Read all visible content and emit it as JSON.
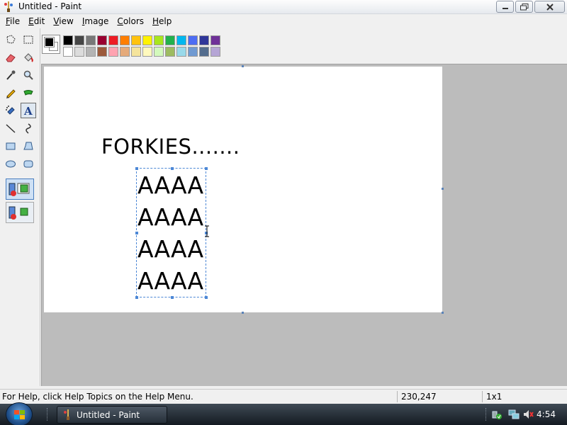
{
  "window": {
    "title": "Untitled - Paint"
  },
  "menu": [
    {
      "underline": "F",
      "rest": "ile"
    },
    {
      "underline": "E",
      "rest": "dit"
    },
    {
      "underline": "V",
      "rest": "iew"
    },
    {
      "underline": "I",
      "rest": "mage"
    },
    {
      "underline": "C",
      "rest": "olors"
    },
    {
      "underline": "H",
      "rest": "elp"
    }
  ],
  "tools": [
    "free-form-select",
    "select",
    "eraser",
    "fill-with-color",
    "pick-color",
    "magnifier",
    "pencil",
    "brush",
    "airbrush",
    "text",
    "line",
    "curve",
    "rectangle",
    "polygon",
    "ellipse",
    "rounded-rectangle"
  ],
  "selected_tool": "text",
  "colors": {
    "foreground": "#000000",
    "background": "#ffffff",
    "palette": [
      "#000000",
      "#464646",
      "#787878",
      "#990030",
      "#ed1c24",
      "#ff7e00",
      "#ffc20e",
      "#fff200",
      "#a8e61d",
      "#22b14c",
      "#00b7ef",
      "#4d6df3",
      "#2f3699",
      "#6f3198",
      "#ffffff",
      "#dcdcdc",
      "#b4b4b4",
      "#9c5a3c",
      "#ffa3b1",
      "#e5aa7a",
      "#f5e49c",
      "#fff9bd",
      "#d3f9bc",
      "#9dbb61",
      "#99d9ea",
      "#709ad1",
      "#546d8e",
      "#b5a5d5"
    ]
  },
  "canvas": {
    "heading": "FORKIES.......",
    "lines": [
      "AAAA",
      "AAAA",
      "AAAA",
      "AAAA"
    ]
  },
  "status": {
    "help": "For Help, click Help Topics on the Help Menu.",
    "coords": "230,247",
    "size": "1x1"
  },
  "taskbar": {
    "task_label": "Untitled - Paint",
    "clock": "4:54"
  }
}
